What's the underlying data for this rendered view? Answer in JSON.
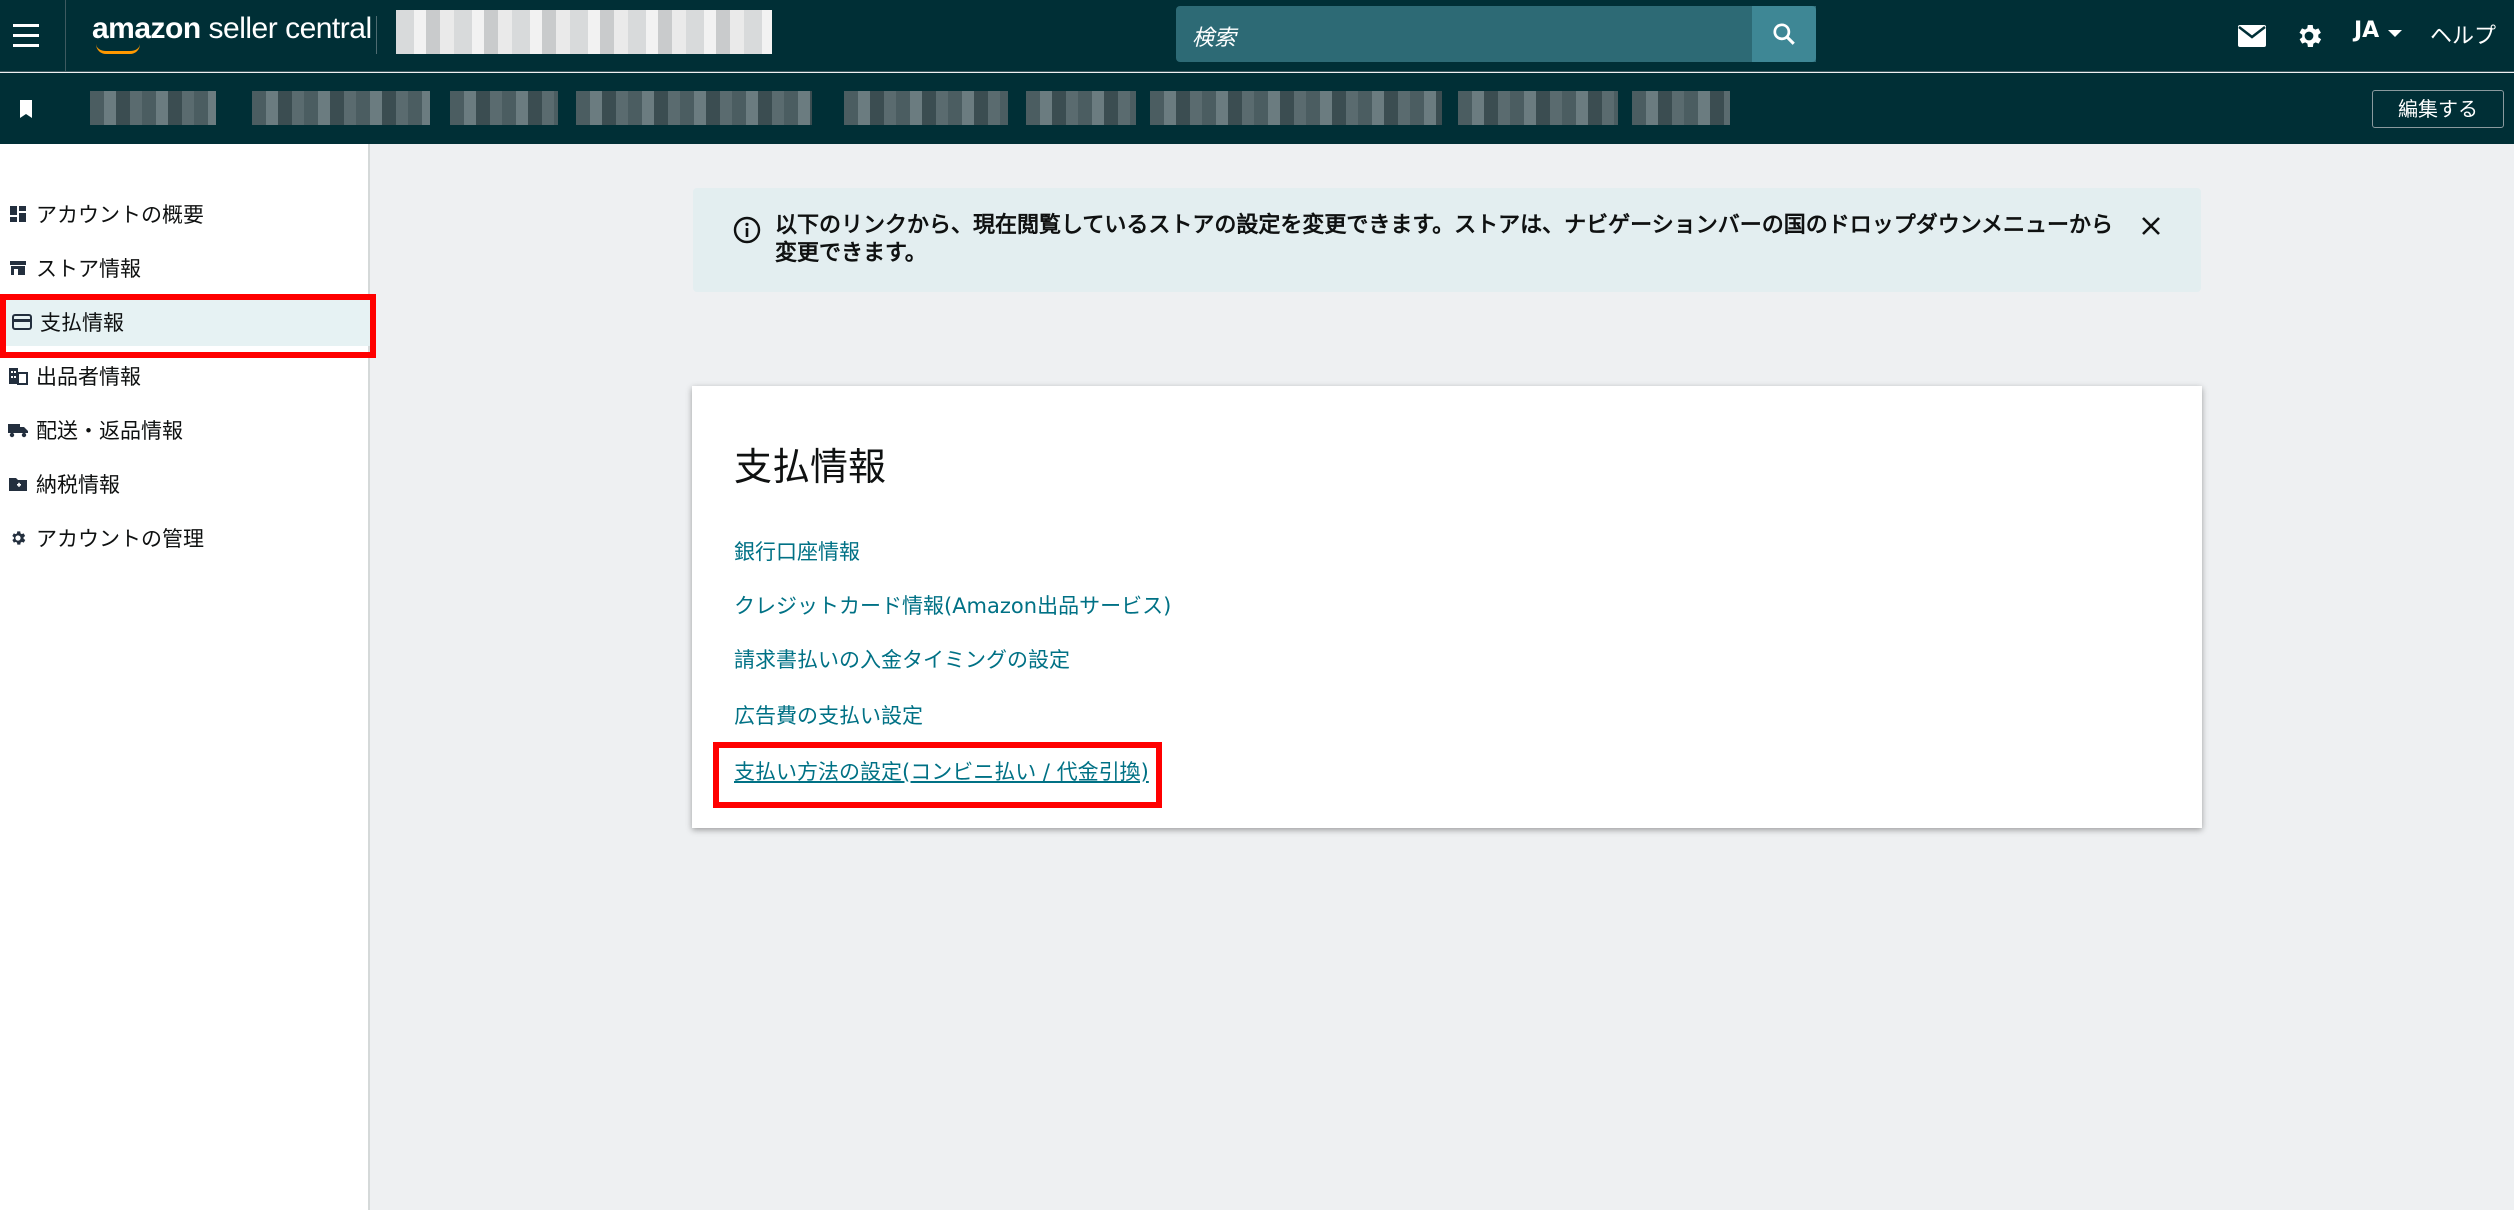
{
  "topbar": {
    "brand_bold": "amazon",
    "brand_rest": " seller central",
    "search_placeholder": "検索",
    "language": "JA",
    "help": "ヘルプ"
  },
  "subbar": {
    "edit_label": "編集する"
  },
  "sidebar": {
    "items": [
      {
        "label": "アカウントの概要",
        "icon": "dashboard-icon"
      },
      {
        "label": "ストア情報",
        "icon": "store-icon"
      },
      {
        "label": "支払情報",
        "icon": "credit-card-icon"
      },
      {
        "label": "出品者情報",
        "icon": "business-icon"
      },
      {
        "label": "配送・返品情報",
        "icon": "truck-icon"
      },
      {
        "label": "納税情報",
        "icon": "tax-folder-icon"
      },
      {
        "label": "アカウントの管理",
        "icon": "gear-icon"
      }
    ]
  },
  "banner": {
    "text": "以下のリンクから、現在閲覧しているストアの設定を変更できます。ストアは、ナビゲーションバーの国のドロップダウンメニューから変更できます。"
  },
  "card": {
    "title": "支払情報",
    "links": [
      "銀行口座情報",
      "クレジットカード情報(Amazon出品サービス)",
      "請求書払いの入金タイミングの設定",
      "広告費の支払い設定",
      "支払い方法の設定(コンビニ払い / 代金引換)"
    ]
  },
  "colors": {
    "topbar_bg": "#002f36",
    "link": "#007185",
    "highlight": "#ff0000"
  }
}
